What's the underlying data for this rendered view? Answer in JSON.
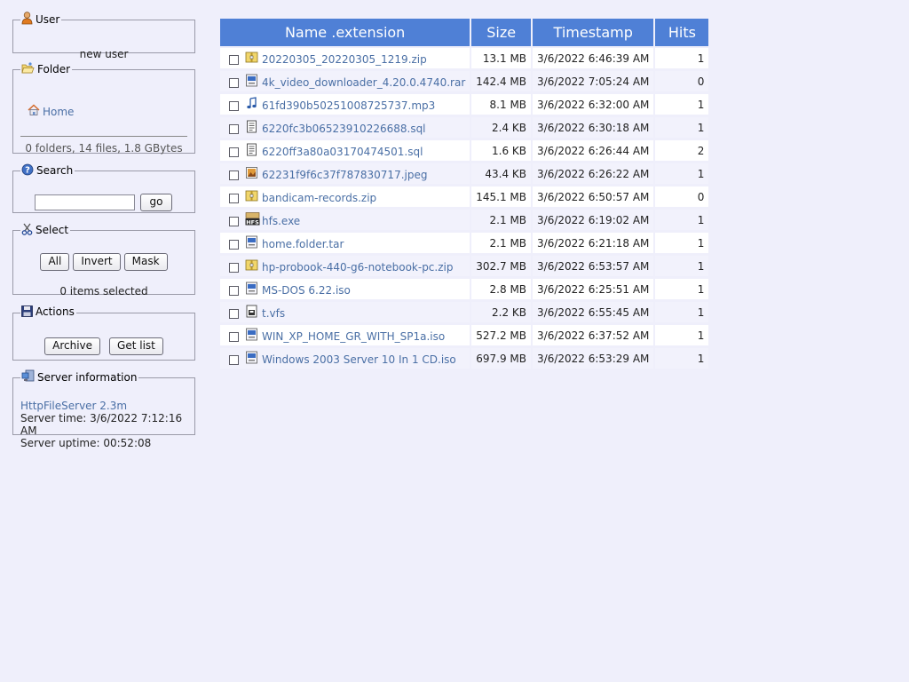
{
  "user": {
    "legend": "User",
    "name": "new user"
  },
  "folder": {
    "legend": "Folder",
    "home_label": "Home",
    "stats": "0 folders, 14 files, 1.8 GBytes"
  },
  "search": {
    "legend": "Search",
    "value": "",
    "go_label": "go"
  },
  "select": {
    "legend": "Select",
    "all_label": "All",
    "invert_label": "Invert",
    "mask_label": "Mask",
    "count_text": "0 items selected"
  },
  "actions": {
    "legend": "Actions",
    "archive_label": "Archive",
    "getlist_label": "Get list"
  },
  "server": {
    "legend": "Server information",
    "version": "HttpFileServer 2.3m",
    "time": "Server time: 3/6/2022 7:12:16 AM",
    "uptime": "Server uptime: 00:52:08"
  },
  "table": {
    "headers": {
      "name": "Name .extension",
      "size": "Size",
      "timestamp": "Timestamp",
      "hits": "Hits"
    },
    "rows": [
      {
        "name": "20220305_20220305_1219.zip",
        "size": "13.1 MB",
        "timestamp": "3/6/2022 6:46:39 AM",
        "hits": "1",
        "icon": "zip-icon"
      },
      {
        "name": "4k_video_downloader_4.20.0.4740.rar",
        "size": "142.4 MB",
        "timestamp": "3/6/2022 7:05:24 AM",
        "hits": "0",
        "icon": "archive-icon"
      },
      {
        "name": "61fd390b50251008725737.mp3",
        "size": "8.1 MB",
        "timestamp": "3/6/2022 6:32:00 AM",
        "hits": "1",
        "icon": "music-icon"
      },
      {
        "name": "6220fc3b06523910226688.sql",
        "size": "2.4 KB",
        "timestamp": "3/6/2022 6:30:18 AM",
        "hits": "1",
        "icon": "text-file-icon"
      },
      {
        "name": "6220ff3a80a03170474501.sql",
        "size": "1.6 KB",
        "timestamp": "3/6/2022 6:26:44 AM",
        "hits": "2",
        "icon": "text-file-icon"
      },
      {
        "name": "62231f9f6c37f787830717.jpeg",
        "size": "43.4 KB",
        "timestamp": "3/6/2022 6:26:22 AM",
        "hits": "1",
        "icon": "image-icon"
      },
      {
        "name": "bandicam-records.zip",
        "size": "145.1 MB",
        "timestamp": "3/6/2022 6:50:57 AM",
        "hits": "0",
        "icon": "zip-icon"
      },
      {
        "name": "hfs.exe",
        "size": "2.1 MB",
        "timestamp": "3/6/2022 6:19:02 AM",
        "hits": "1",
        "icon": "hfs-app-icon"
      },
      {
        "name": "home.folder.tar",
        "size": "2.1 MB",
        "timestamp": "3/6/2022 6:21:18 AM",
        "hits": "1",
        "icon": "archive-icon"
      },
      {
        "name": "hp-probook-440-g6-notebook-pc.zip",
        "size": "302.7 MB",
        "timestamp": "3/6/2022 6:53:57 AM",
        "hits": "1",
        "icon": "zip-icon"
      },
      {
        "name": "MS-DOS 6.22.iso",
        "size": "2.8 MB",
        "timestamp": "3/6/2022 6:25:51 AM",
        "hits": "1",
        "icon": "archive-icon"
      },
      {
        "name": "t.vfs",
        "size": "2.2 KB",
        "timestamp": "3/6/2022 6:55:45 AM",
        "hits": "1",
        "icon": "vfs-file-icon"
      },
      {
        "name": "WIN_XP_HOME_GR_WITH_SP1a.iso",
        "size": "527.2 MB",
        "timestamp": "3/6/2022 6:37:52 AM",
        "hits": "1",
        "icon": "archive-icon"
      },
      {
        "name": "Windows 2003 Server 10 In 1 CD.iso",
        "size": "697.9 MB",
        "timestamp": "3/6/2022 6:53:29 AM",
        "hits": "1",
        "icon": "archive-icon"
      }
    ]
  }
}
